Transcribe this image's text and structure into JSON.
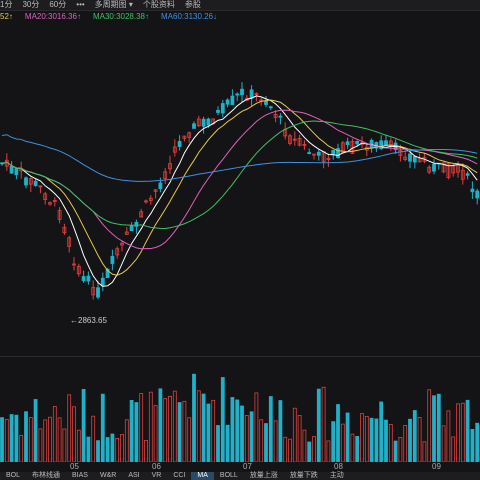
{
  "toolbar": {
    "items": [
      "1分",
      "30分",
      "60分",
      "•••",
      "多周期图 ▾",
      "个股资料",
      "参股"
    ]
  },
  "ma_legend": [
    {
      "label": "52↑",
      "color": "#e8c84a"
    },
    {
      "label": "MA20:3016.36↑",
      "color": "#e060c0"
    },
    {
      "label": "MA30:3028.38↑",
      "color": "#40c060"
    },
    {
      "label": "MA60:3130.26↓",
      "color": "#4090e0"
    }
  ],
  "min_label": "2863.65",
  "months": [
    "05",
    "06",
    "07",
    "08",
    "09"
  ],
  "bottom_tabs": [
    "BOL",
    "布林线通",
    "BIAS",
    "W&R",
    "ASI",
    "VR",
    "CCI",
    "MA",
    "BOLL",
    "放量上涨",
    "放量下跌",
    "主动"
  ],
  "active_tab": "MA",
  "colors": {
    "up": "#e0403c",
    "down": "#20b0c8",
    "ma5": "#ffffff",
    "ma10": "#e8c84a",
    "ma20": "#e060c0",
    "ma30": "#40c060",
    "ma60": "#4090e0"
  },
  "chart_data": {
    "type": "candlestick",
    "min_marker": 2863.65,
    "price_range": [
      2840,
      3330
    ]
  }
}
